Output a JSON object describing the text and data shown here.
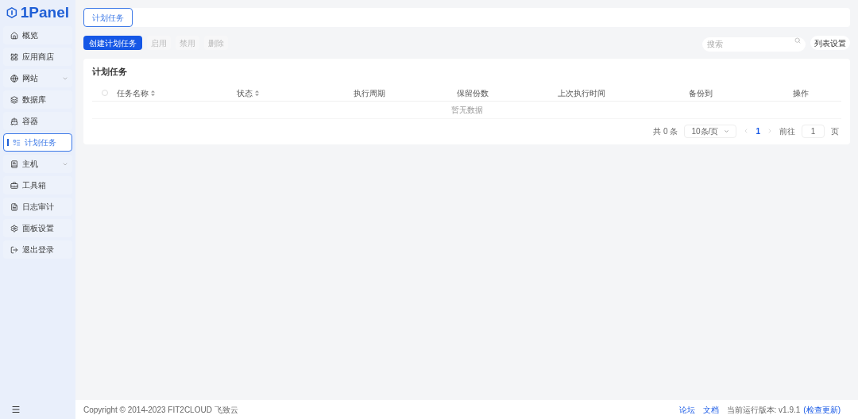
{
  "logo": {
    "text": "1Panel"
  },
  "sidebar": {
    "items": [
      {
        "label": "概览",
        "selected": false,
        "expandable": false
      },
      {
        "label": "应用商店",
        "selected": false,
        "expandable": false
      },
      {
        "label": "网站",
        "selected": false,
        "expandable": true
      },
      {
        "label": "数据库",
        "selected": false,
        "expandable": false
      },
      {
        "label": "容器",
        "selected": false,
        "expandable": false
      },
      {
        "label": "计划任务",
        "selected": true,
        "expandable": false
      },
      {
        "label": "主机",
        "selected": false,
        "expandable": true
      },
      {
        "label": "工具箱",
        "selected": false,
        "expandable": false
      },
      {
        "label": "日志审计",
        "selected": false,
        "expandable": false
      },
      {
        "label": "面板设置",
        "selected": false,
        "expandable": false
      },
      {
        "label": "退出登录",
        "selected": false,
        "expandable": false
      }
    ]
  },
  "tabs": [
    {
      "label": "计划任务",
      "selected": true
    }
  ],
  "toolbar": {
    "primary": "创建计划任务",
    "buttons": [
      {
        "label": "启用",
        "disabled": true
      },
      {
        "label": "禁用",
        "disabled": true
      },
      {
        "label": "删除",
        "disabled": true
      }
    ],
    "search": {
      "placeholder": "搜索"
    },
    "column_settings": "列表设置"
  },
  "table": {
    "title": "计划任务",
    "select_all": {
      "checked": false
    },
    "columns": [
      {
        "label": "任务名称",
        "sortable": true
      },
      {
        "label": "状态",
        "sortable": true
      },
      {
        "label": "执行周期",
        "sortable": false
      },
      {
        "label": "保留份数",
        "sortable": false
      },
      {
        "label": "上次执行时间",
        "sortable": false
      },
      {
        "label": "备份到",
        "sortable": false
      },
      {
        "label": "操作",
        "sortable": false
      }
    ],
    "empty": "暂无数据"
  },
  "pagination": {
    "total": "共 0 条",
    "page_size": "10条/页",
    "pages": [
      {
        "label": "1",
        "selected": true
      }
    ],
    "goto_label": "前往",
    "goto_value": "1",
    "goto_suffix": "页"
  },
  "footer": {
    "copyright": "Copyright © 2014-2023 FIT2CLOUD 飞致云",
    "links": [
      "论坛",
      "文档"
    ],
    "version": "当前运行版本: v1.9.1",
    "check_update": "(检查更新)"
  }
}
